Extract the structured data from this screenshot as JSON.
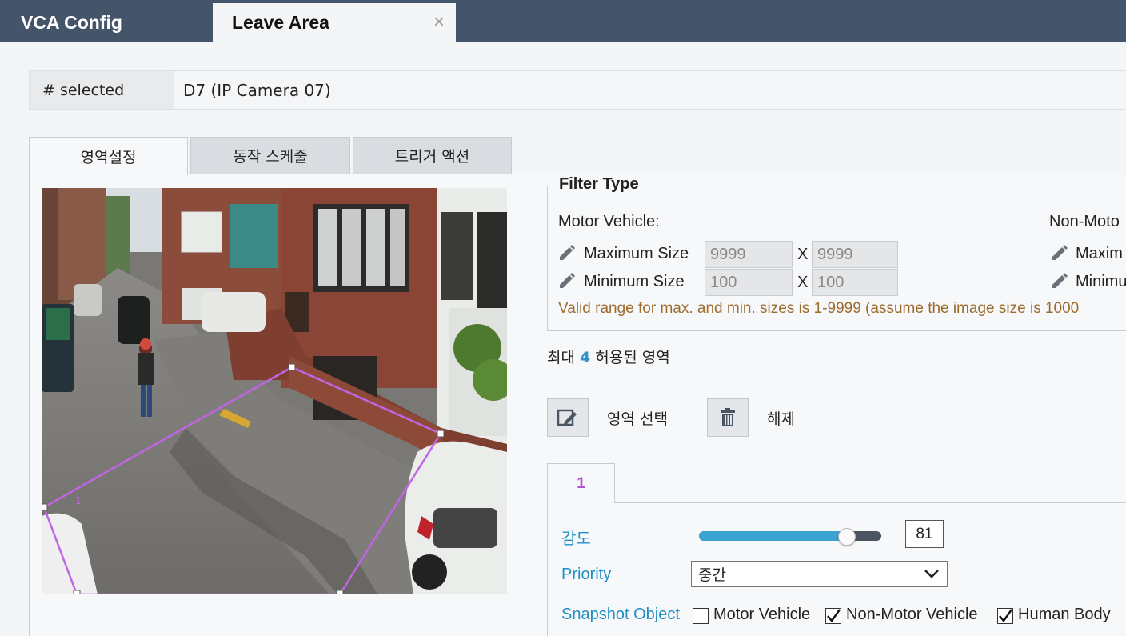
{
  "tabs": [
    {
      "label": "VCA Config",
      "active": false
    },
    {
      "label": "Leave Area",
      "active": true,
      "closable": true
    }
  ],
  "close_glyph": "×",
  "selected": {
    "label": "# selected",
    "value": "D7 (IP Camera 07)"
  },
  "subtabs": [
    "영역설정",
    "동작 스케줄",
    "트리거 액션"
  ],
  "filter": {
    "title": "Filter Type",
    "motor_label": "Motor Vehicle:",
    "nonmotor_label": "Non-Moto",
    "max_label": "Maximum Size",
    "min_label": "Minimum Size",
    "max_label_right": "Maxim",
    "min_label_right": "Minimu",
    "max_w": "9999",
    "max_h": "9999",
    "min_w": "100",
    "min_h": "100",
    "x": "X",
    "range_note": "Valid range for max. and min. sizes is 1-9999 (assume the image size is 1000"
  },
  "max_area": {
    "prefix": "최대",
    "count": "4",
    "suffix": "허용된 영역"
  },
  "buttons": {
    "select_area": "영역 선택",
    "clear": "해제"
  },
  "zone_tab": "1",
  "sensitivity": {
    "label": "감도",
    "value": "81",
    "fraction": 0.81
  },
  "priority": {
    "label": "Priority",
    "value": "중간"
  },
  "snapshot": {
    "label": "Snapshot Object",
    "options": [
      {
        "label": "Motor Vehicle",
        "checked": false
      },
      {
        "label": "Non-Motor Vehicle",
        "checked": true
      },
      {
        "label": "Human Body",
        "checked": true
      }
    ]
  },
  "colors": {
    "accent": "#2f93c9",
    "zone": "#b050d8",
    "topbar": "#44546a",
    "warning": "#9c6b2e"
  },
  "icons": [
    "pencil-icon",
    "edit-area-icon",
    "trash-icon",
    "chevron-down-icon",
    "checkmark-icon"
  ]
}
